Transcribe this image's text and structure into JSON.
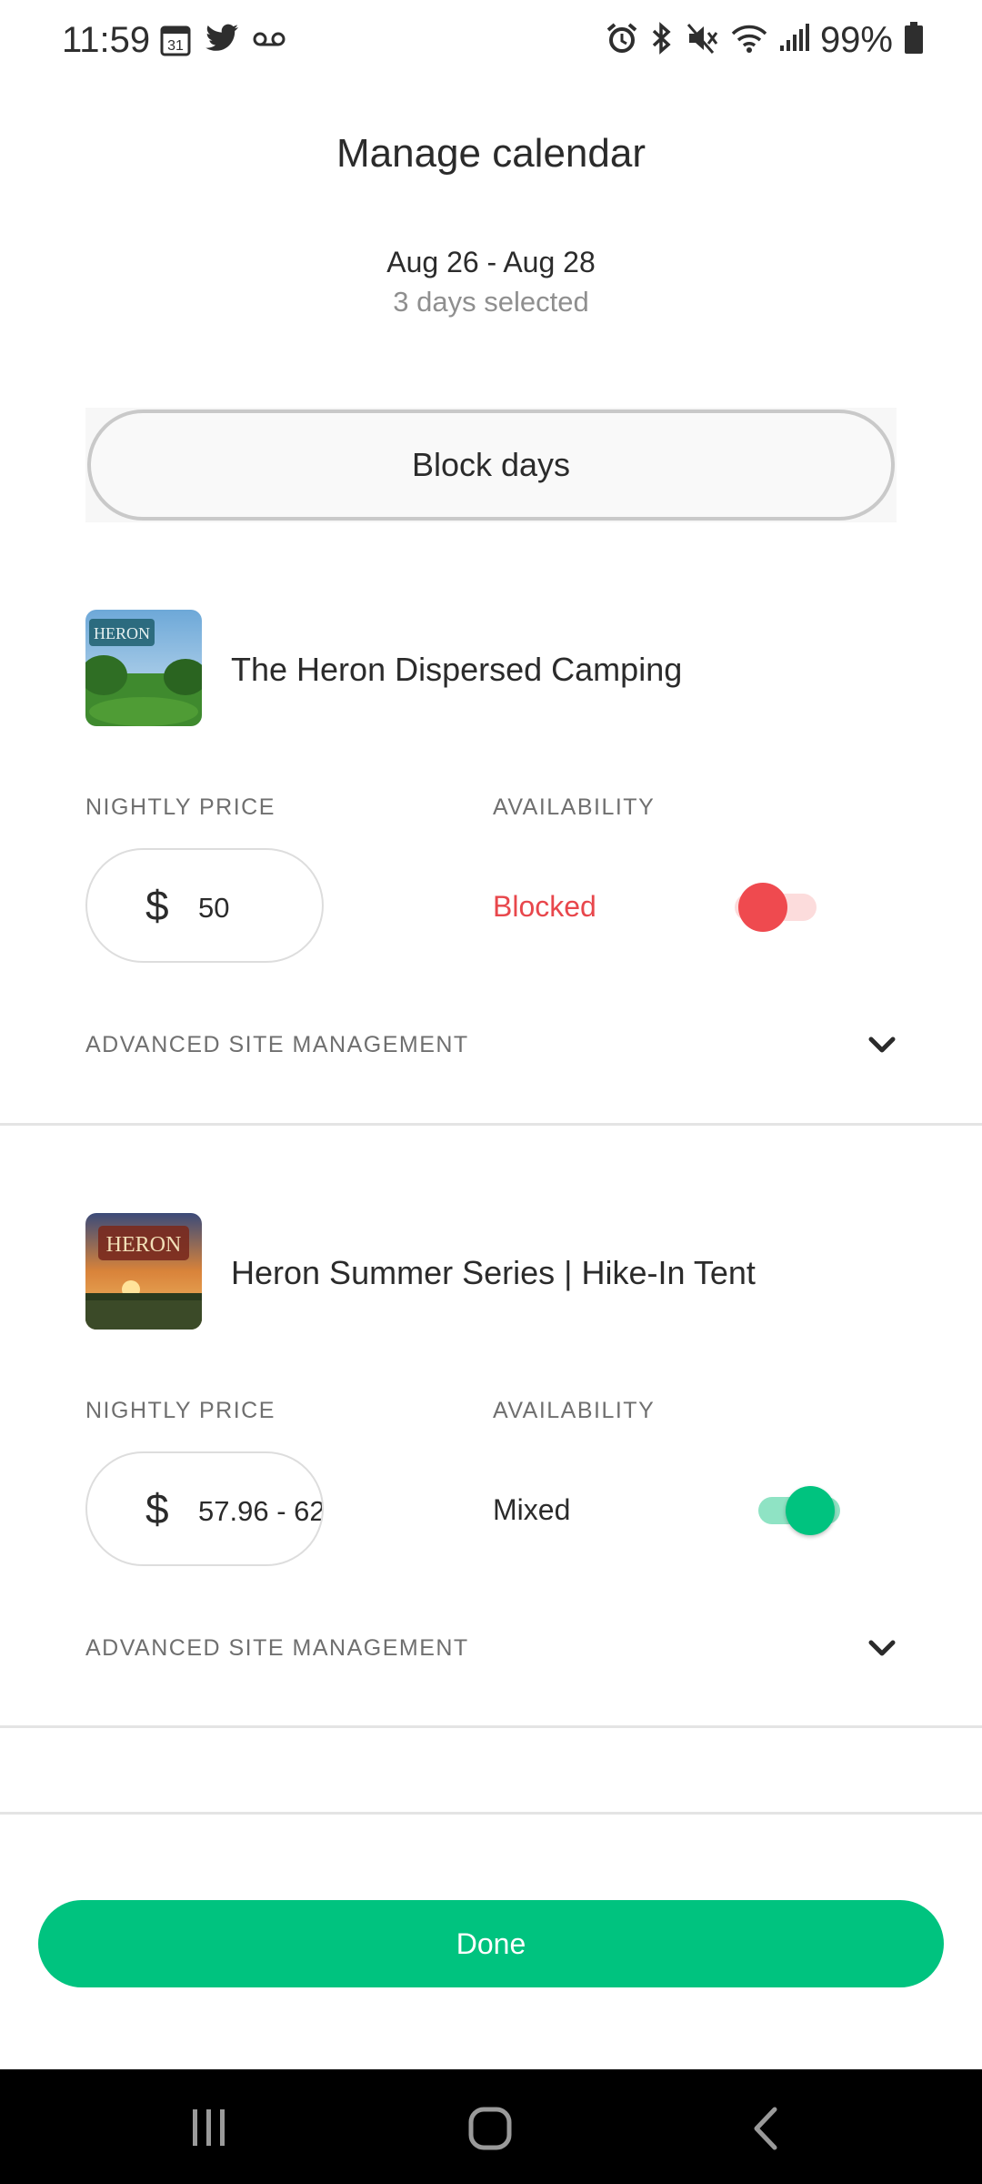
{
  "status_bar": {
    "time": "11:59",
    "calendar_icon_text": "31",
    "battery_percent": "99%",
    "left_icons": [
      "calendar-icon",
      "twitter-icon",
      "voicemail-icon"
    ],
    "right_icons": [
      "alarm-icon",
      "bluetooth-icon",
      "mute-icon",
      "wifi-icon",
      "signal-icon",
      "battery-icon"
    ]
  },
  "header": {
    "title": "Manage calendar",
    "date_range": "Aug 26 - Aug 28",
    "days_selected": "3 days selected"
  },
  "block_days_label": "Block days",
  "sites": [
    {
      "name": "The Heron Dispersed Camping",
      "nightly_price_label": "NIGHTLY PRICE",
      "availability_label": "AVAILABILITY",
      "currency": "$",
      "price": "50",
      "availability": "Blocked",
      "toggle_on": false,
      "advanced_label": "ADVANCED SITE MANAGEMENT"
    },
    {
      "name": "Heron Summer Series | Hike-In Tent",
      "nightly_price_label": "NIGHTLY PRICE",
      "availability_label": "AVAILABILITY",
      "currency": "$",
      "price": "57.96 - 62",
      "availability": "Mixed",
      "toggle_on": true,
      "advanced_label": "ADVANCED SITE MANAGEMENT"
    }
  ],
  "done_label": "Done",
  "colors": {
    "accent_green": "#00c37f",
    "blocked_red": "#e8474c",
    "toggle_off_track": "#fcdcdc",
    "toggle_on_track": "#8fe3c4"
  }
}
